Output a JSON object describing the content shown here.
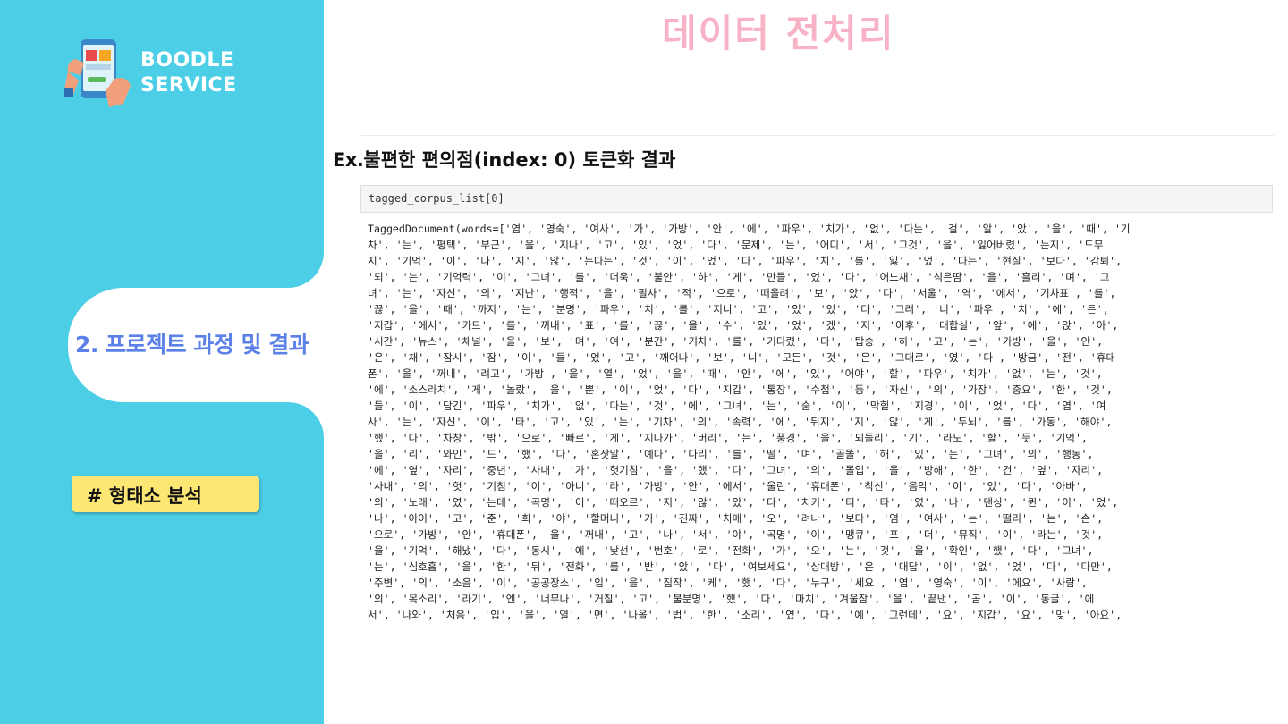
{
  "brand": {
    "line1": "BOODLE",
    "line2": "SERVICE",
    "logo_icon": "phone-shopping-icon"
  },
  "page": {
    "title": "데이터 전처리"
  },
  "sidebar": {
    "active_section": "2. 프로젝트 과정 및 결과",
    "tag": "# 형태소 분석"
  },
  "content": {
    "ex_prefix": "Ex.",
    "ex_title": "불편한 편의점(index: 0) 토큰화 결과",
    "code_input": "tagged_corpus_list[0]",
    "output_lines": [
      "TaggedDocument(words=['염', '영숙', '여사', '가', '가방', '안', '에', '파우', '치가', '없', '다는', '걸', '알', '았', '을', '때', '기",
      "차', '는', '평택', '부근', '을', '지나', '고', '있', '었', '다', '문제', '는', '어디', '서', '그것', '을', '잃어버렸', '는지', '도무",
      "지', '기억', '이', '나', '지', '않', '는다는', '것', '이', '었', '다', '파우', '치', '를', '잃', '었', '다는', '현실', '보다', '감퇴',",
      "'되', '는', '기억력', '이', '그녀', '를', '더욱', '불안', '하', '게', '만들', '었', '다', '어느새', '식은땀', '을', '흘리', '며', '그",
      "녀', '는', '자신', '의', '지난', '행적', '을', '필사', '적', '으로', '떠올려', '보', '았', '다', '서울', '역', '에서', '기차표', '를',",
      "'끊', '을', '때', '까지', '는', '분명', '파우', '치', '를', '지니', '고', '있', '었', '다', '그러', '니', '파우', '치', '에', '든',",
      "'지갑', '에서', '카드', '를', '꺼내', '표', '를', '끊', '을', '수', '있', '었', '겠', '지', '이후', '대합실', '앞', '에', '앉', '아',",
      "'시간', '뉴스', '채널', '을', '보', '며', '여', '분간', '기차', '를', '기다렸', '다', '탑승', '하', '고', '는', '가방', '을', '안',",
      "'은', '채', '잠시', '잠', '이', '들', '었', '고', '깨어나', '보', '니', '모든', '것', '은', '그대로', '였', '다', '방금', '전', '휴대",
      "폰', '을', '꺼내', '려고', '가방', '을', '열', '었', '을', '때', '안', '에', '있', '어야', '할', '파우', '치가', '없', '는', '것',",
      "'에', '소스라치', '게', '놀랐', '을', '뿐', '이', '었', '다', '지갑', '통장', '수첩', '등', '자신', '의', '가장', '중요', '한', '것',",
      "'들', '이', '담긴', '파우', '치가', '없', '다는', '것', '에', '그녀', '는', '숨', '이', '막힐', '지경', '이', '었', '다', '염', '여",
      "사', '는', '자신', '이', '타', '고', '있', '는', '기차', '의', '속력', '에', '뒤지', '지', '않', '게', '두뇌', '를', '가동', '해야',",
      "'했', '다', '차창', '밖', '으로', '빠르', '게', '지나가', '버리', '는', '풍경', '을', '되돌리', '기', '라도', '할', '듯', '기억',",
      "'을', '리', '와인', '드', '했', '다', '혼잣말', '예다', '다리', '를', '떨', '며', '골똘', '해', '있', '는', '그녀', '의', '행동',",
      "'에', '옆', '자리', '중년', '사내', '가', '헛기침', '을', '했', '다', '그녀', '의', '몰입', '을', '방해', '한', '건', '옆', '자리',",
      "'사내', '의', '헛', '기침', '이', '아니', '라', '가방', '안', '에서', '울린', '휴대폰', '착신', '음악', '이', '었', '다', '아바',",
      "'의', '노래', '였', '는데', '곡명', '이', '떠오르', '지', '않', '았', '다', '치키', '티', '타', '였', '나', '댄싱', '퀸', '이', '었',",
      "'나', '아이', '고', '준', '희', '야', '할머니', '가', '진짜', '치매', '오', '려나', '보다', '염', '여사', '는', '떨리', '는', '손',",
      "'으로', '가방', '안', '휴대폰', '을', '꺼내', '고', '나', '서', '야', '곡명', '이', '맹큐', '포', '더', '뮤직', '이', '라는', '것',",
      "'을', '기억', '해냈', '다', '동시', '에', '낯선', '번호', '로', '전화', '가', '오', '는', '것', '을', '확인', '했', '다', '그녀',",
      "'는', '심호흡', '을', '한', '뒤', '전화', '를', '받', '았', '다', '여보세요', '상대방', '은', '대답', '이', '없', '었', '다', '다만',",
      "'주변', '의', '소음', '이', '공공장소', '임', '을', '짐작', '케', '했', '다', '누구', '세요', '염', '영숙', '이', '에요', '사람',",
      "'의', '목소리', '라기', '엔', '너무나', '거칠', '고', '불분명', '했', '다', '마치', '겨울잠', '을', '끝낸', '곰', '이', '동굴', '에",
      "서', '나와', '처음', '입', '을', '열', '면', '나올', '법', '한', '소리', '였', '다', '예', '그런데', '요', '지갑', '요', '맞', '아요',"
    ]
  }
}
